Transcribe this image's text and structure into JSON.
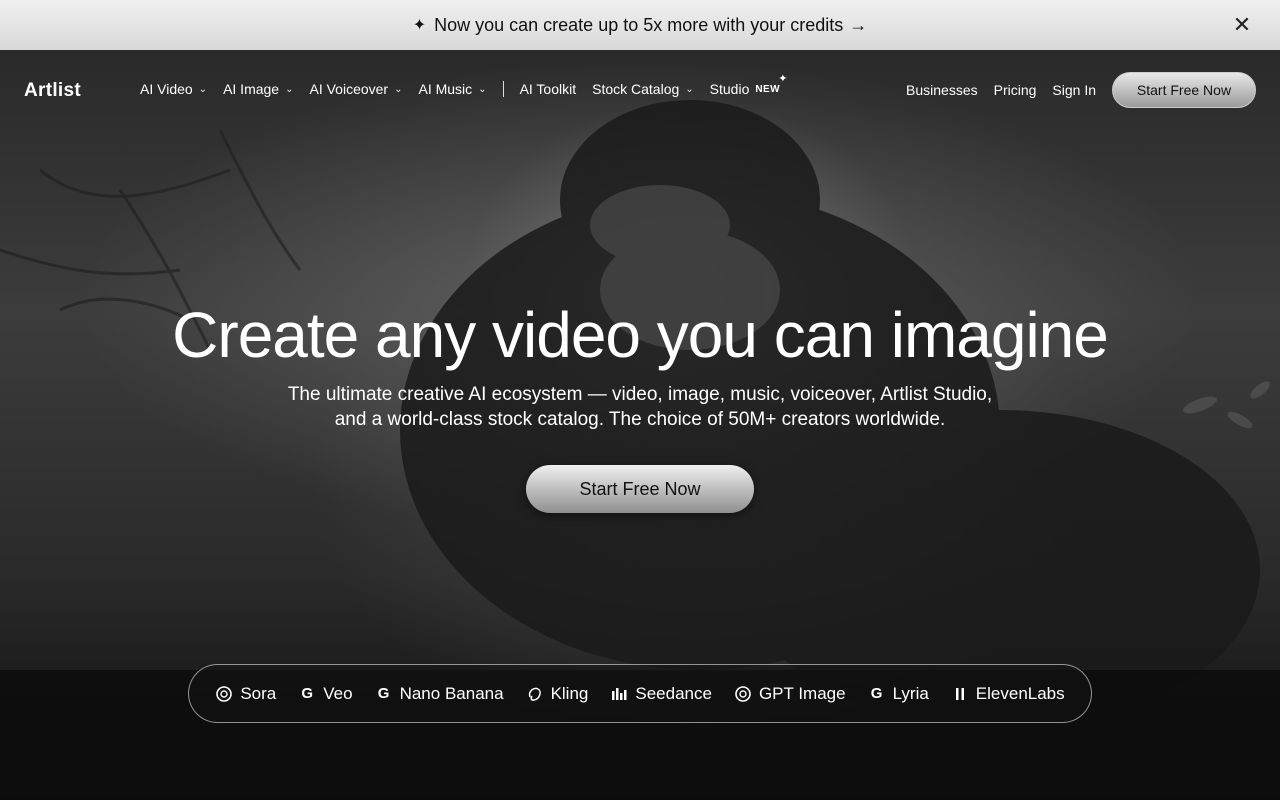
{
  "announcement": {
    "text": "Now you can create up to 5x more with your credits",
    "arrow": "→",
    "close": "✕"
  },
  "nav": {
    "logo": "Artlist",
    "links": [
      {
        "label": "AI Video"
      },
      {
        "label": "AI Image"
      },
      {
        "label": "AI Voiceover"
      },
      {
        "label": "AI Music"
      },
      {
        "label": "AI Toolkit"
      },
      {
        "label": "Stock Catalog"
      },
      {
        "label": "Studio"
      }
    ],
    "new_badge": "NEW",
    "right": {
      "businesses": "Businesses",
      "pricing": "Pricing",
      "sign_in": "Sign In",
      "cta": "Start Free Now"
    }
  },
  "hero": {
    "title": "Create any video you can imagine",
    "subtitle_line1": "The ultimate creative AI ecosystem — video, image, music, voiceover, Artlist Studio,",
    "subtitle_line2": "and a world-class stock catalog. The choice of 50M+ creators worldwide.",
    "cta": "Start Free Now"
  },
  "models": [
    {
      "label": "Sora",
      "icon": "openai-icon"
    },
    {
      "label": "Veo",
      "icon": "google-icon"
    },
    {
      "label": "Nano Banana",
      "icon": "google-icon"
    },
    {
      "label": "Kling",
      "icon": "kling-icon"
    },
    {
      "label": "Seedance",
      "icon": "bars-icon"
    },
    {
      "label": "GPT Image",
      "icon": "openai-icon"
    },
    {
      "label": "Lyria",
      "icon": "google-icon"
    },
    {
      "label": "ElevenLabs",
      "icon": "elevenlabs-icon"
    }
  ]
}
